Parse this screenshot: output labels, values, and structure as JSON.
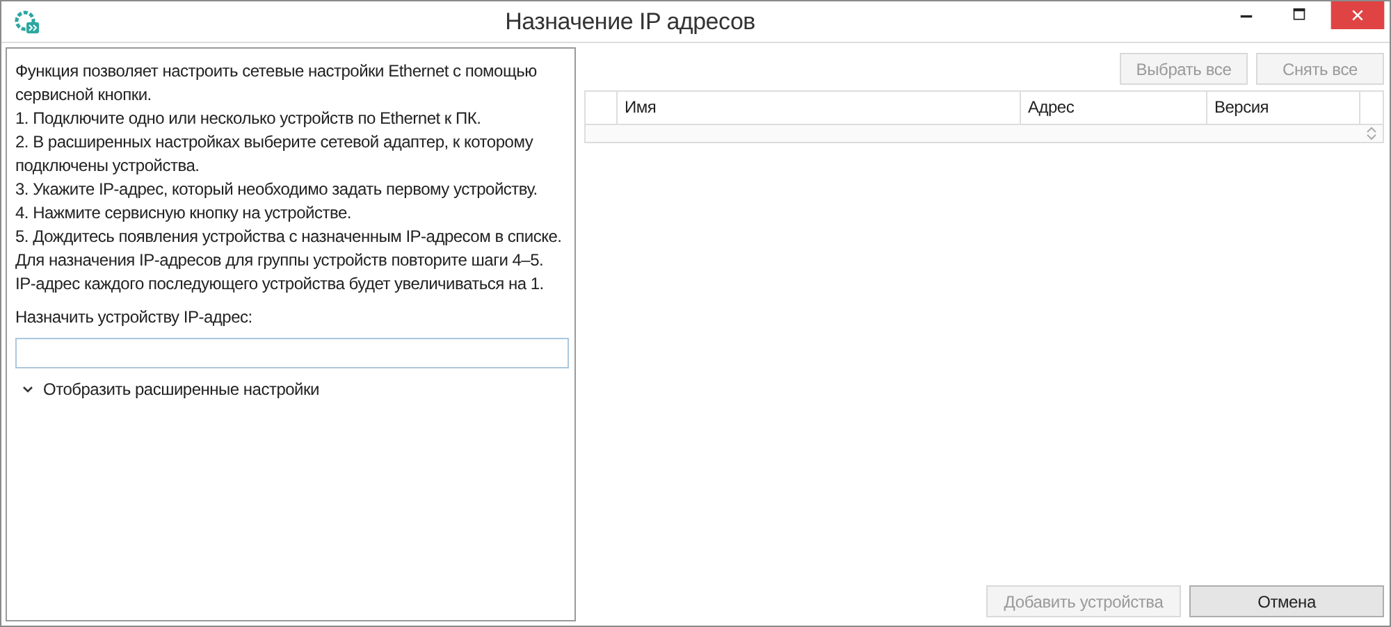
{
  "window": {
    "title": "Назначение IP адресов"
  },
  "instructions": [
    "Функция позволяет настроить сетевые настройки Ethernet с помощью сервисной кнопки.",
    "1. Подключите одно или несколько устройств по Ethernet к ПК.",
    "2. В расширенных настройках выберите сетевой адаптер, к которому подключены устройства.",
    "3. Укажите IP-адрес, который необходимо задать первому устройству.",
    "4. Нажмите сервисную кнопку на устройстве.",
    "5. Дождитесь появления устройства с назначенным IP-адресом в списке.",
    "Для назначения IP-адресов для группы устройств повторите шаги 4–5.",
    "IP-адрес каждого последующего устройства будет увеличиваться на 1."
  ],
  "ip_field": {
    "label": "Назначить устройству IP-адрес:"
  },
  "advanced": {
    "label": "Отобразить расширенные настройки",
    "expanded": false
  },
  "top_buttons": [
    {
      "label": "Выбрать все",
      "disabled": true
    },
    {
      "label": "Снять все",
      "disabled": true
    }
  ],
  "table": {
    "columns": [
      "Имя",
      "Адрес",
      "Версия"
    ]
  },
  "bottom_buttons": [
    {
      "label": "Добавить устройства",
      "disabled": true
    },
    {
      "label": "Отмена",
      "disabled": false
    }
  ]
}
